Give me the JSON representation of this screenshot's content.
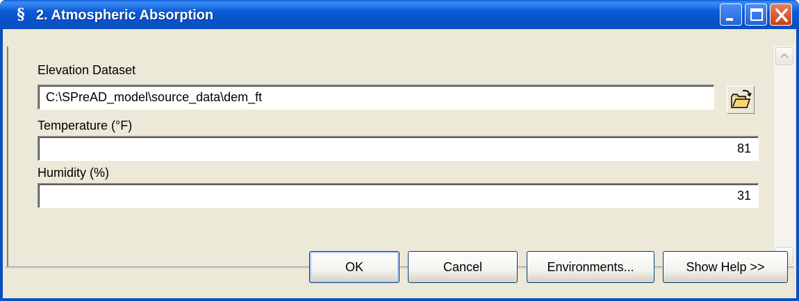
{
  "window": {
    "title": "2. Atmospheric Absorption",
    "icon": "script-s-icon"
  },
  "form": {
    "elevation": {
      "label": "Elevation Dataset",
      "value": "C:\\SPreAD_model\\source_data\\dem_ft"
    },
    "temperature": {
      "label": "Temperature (°F)",
      "value": "81"
    },
    "humidity": {
      "label": "Humidity (%)",
      "value": "31"
    }
  },
  "buttons": {
    "ok": "OK",
    "cancel": "Cancel",
    "environments": "Environments...",
    "show_help": "Show Help >>"
  },
  "colors": {
    "titlebar": "#0b5ad5",
    "client_bg": "#ece9d8",
    "close_button": "#d4532c"
  }
}
